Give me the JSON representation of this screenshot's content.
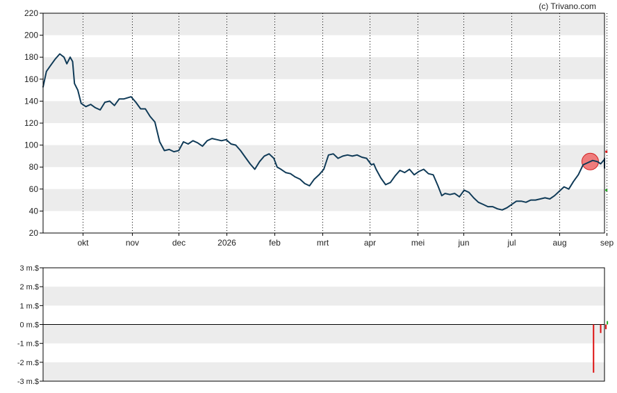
{
  "credit": "(c) Trivano.com",
  "colors": {
    "price_line": "#0f3a57",
    "band": "#ececec",
    "axis": "#000000",
    "gridline": "#000000",
    "marker_fill": "#ef7070",
    "marker_stroke": "#d02020",
    "volume_negative": "#dd1111",
    "volume_positive": "#22aa22",
    "volume_zero_line": "#000000"
  },
  "chart_data": [
    {
      "type": "line",
      "title": "",
      "xlabel": "",
      "ylabel": "",
      "ylim": [
        20,
        220
      ],
      "y_ticks": [
        20,
        40,
        60,
        80,
        100,
        120,
        140,
        160,
        180,
        200,
        220
      ],
      "x_tick_labels": [
        "okt",
        "nov",
        "dec",
        "2026",
        "feb",
        "mrt",
        "apr",
        "mei",
        "jun",
        "jul",
        "aug",
        "sep"
      ],
      "x_range_months": [
        0,
        11.8
      ],
      "x_tick_positions": [
        0.83,
        1.87,
        2.85,
        3.85,
        4.87,
        5.87,
        6.87,
        7.87,
        8.83,
        9.85,
        10.85,
        11.85
      ],
      "grid": "vertical-dotted-at-month-ticks, alternating-horizontal-bands",
      "series": [
        {
          "points": [
            [
              0.0,
              153
            ],
            [
              0.07,
              167
            ],
            [
              0.15,
              172
            ],
            [
              0.25,
              178
            ],
            [
              0.35,
              183
            ],
            [
              0.44,
              180
            ],
            [
              0.5,
              174
            ],
            [
              0.57,
              180
            ],
            [
              0.62,
              176
            ],
            [
              0.66,
              156
            ],
            [
              0.73,
              150
            ],
            [
              0.8,
              138
            ],
            [
              0.9,
              135
            ],
            [
              1.0,
              137
            ],
            [
              1.1,
              134
            ],
            [
              1.2,
              132
            ],
            [
              1.3,
              139
            ],
            [
              1.4,
              140
            ],
            [
              1.5,
              136
            ],
            [
              1.6,
              142
            ],
            [
              1.7,
              142
            ],
            [
              1.85,
              144
            ],
            [
              1.95,
              139
            ],
            [
              2.05,
              133
            ],
            [
              2.15,
              133
            ],
            [
              2.25,
              126
            ],
            [
              2.35,
              121
            ],
            [
              2.45,
              103
            ],
            [
              2.55,
              95
            ],
            [
              2.65,
              96
            ],
            [
              2.75,
              94
            ],
            [
              2.85,
              95
            ],
            [
              2.95,
              103
            ],
            [
              3.05,
              101
            ],
            [
              3.15,
              104
            ],
            [
              3.25,
              102
            ],
            [
              3.35,
              99
            ],
            [
              3.45,
              104
            ],
            [
              3.55,
              106
            ],
            [
              3.65,
              105
            ],
            [
              3.75,
              104
            ],
            [
              3.85,
              105
            ],
            [
              3.95,
              101
            ],
            [
              4.05,
              100
            ],
            [
              4.15,
              95
            ],
            [
              4.25,
              89
            ],
            [
              4.35,
              83
            ],
            [
              4.45,
              78
            ],
            [
              4.55,
              85
            ],
            [
              4.65,
              90
            ],
            [
              4.75,
              92
            ],
            [
              4.85,
              88
            ],
            [
              4.92,
              80
            ],
            [
              5.0,
              78
            ],
            [
              5.1,
              75
            ],
            [
              5.2,
              74
            ],
            [
              5.3,
              71
            ],
            [
              5.4,
              69
            ],
            [
              5.5,
              65
            ],
            [
              5.6,
              63
            ],
            [
              5.7,
              69
            ],
            [
              5.8,
              73
            ],
            [
              5.9,
              78
            ],
            [
              6.0,
              91
            ],
            [
              6.1,
              92
            ],
            [
              6.2,
              88
            ],
            [
              6.3,
              90
            ],
            [
              6.4,
              91
            ],
            [
              6.5,
              90
            ],
            [
              6.6,
              91
            ],
            [
              6.7,
              89
            ],
            [
              6.8,
              88
            ],
            [
              6.9,
              82
            ],
            [
              6.95,
              83
            ],
            [
              7.0,
              78
            ],
            [
              7.1,
              70
            ],
            [
              7.2,
              64
            ],
            [
              7.3,
              66
            ],
            [
              7.4,
              72
            ],
            [
              7.5,
              77
            ],
            [
              7.6,
              75
            ],
            [
              7.7,
              78
            ],
            [
              7.8,
              73
            ],
            [
              7.9,
              76
            ],
            [
              8.0,
              78
            ],
            [
              8.1,
              74
            ],
            [
              8.2,
              73
            ],
            [
              8.3,
              63
            ],
            [
              8.38,
              54
            ],
            [
              8.45,
              56
            ],
            [
              8.55,
              55
            ],
            [
              8.65,
              56
            ],
            [
              8.75,
              53
            ],
            [
              8.85,
              59
            ],
            [
              8.95,
              57
            ],
            [
              9.05,
              52
            ],
            [
              9.15,
              48
            ],
            [
              9.25,
              46
            ],
            [
              9.35,
              44
            ],
            [
              9.45,
              44
            ],
            [
              9.55,
              42
            ],
            [
              9.65,
              41
            ],
            [
              9.75,
              43
            ],
            [
              9.85,
              46
            ],
            [
              9.95,
              49
            ],
            [
              10.05,
              49
            ],
            [
              10.15,
              48
            ],
            [
              10.25,
              50
            ],
            [
              10.35,
              50
            ],
            [
              10.45,
              51
            ],
            [
              10.55,
              52
            ],
            [
              10.65,
              51
            ],
            [
              10.75,
              54
            ],
            [
              10.85,
              58
            ],
            [
              10.95,
              62
            ],
            [
              11.05,
              60
            ],
            [
              11.15,
              67
            ],
            [
              11.25,
              73
            ],
            [
              11.35,
              82
            ],
            [
              11.45,
              84
            ],
            [
              11.55,
              86
            ],
            [
              11.65,
              85
            ],
            [
              11.72,
              83
            ],
            [
              11.8,
              87
            ],
            [
              11.88,
              88
            ],
            [
              11.95,
              86
            ],
            [
              12.05,
              79
            ]
          ]
        }
      ],
      "annotations": [
        {
          "kind": "highlight-circle",
          "x": 11.5,
          "y": 85
        },
        {
          "kind": "small-marker",
          "color": "#dd1111",
          "x": 11.84,
          "y": 94
        },
        {
          "kind": "small-marker",
          "color": "#22aa22",
          "x": 11.84,
          "y": 59
        }
      ]
    },
    {
      "type": "bar",
      "title": "",
      "xlabel": "",
      "ylabel": "",
      "ylim": [
        -3,
        3
      ],
      "y_ticks": [
        3,
        2,
        1,
        0,
        -1,
        -2,
        -3
      ],
      "y_tick_labels": [
        "3 m.$",
        "2 m.$",
        "1 m.$",
        "0 m.$",
        "-1 m.$",
        "-2 m.$",
        "-3 m.$"
      ],
      "bars": [
        {
          "x": 11.57,
          "value": -2.55,
          "sign": "negative"
        },
        {
          "x": 11.72,
          "value": -0.45,
          "sign": "negative"
        },
        {
          "x": 11.83,
          "value": -0.25,
          "sign": "negative"
        },
        {
          "x": 11.86,
          "value": 0.18,
          "sign": "positive"
        }
      ]
    }
  ]
}
